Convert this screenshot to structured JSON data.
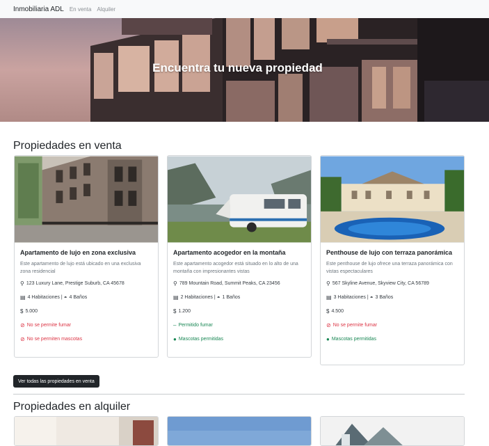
{
  "navbar": {
    "brand": "Inmobiliaria ADL",
    "links": [
      "En venta",
      "Alquiler"
    ]
  },
  "hero": {
    "title": "Encuentra tu nueva propiedad"
  },
  "sale_section": {
    "title": "Propiedades en venta",
    "button": "Ver todas las propiedades en venta",
    "cards": [
      {
        "title": "Apartamento de lujo en zona exclusiva",
        "description": "Este apartamento de lujo está ubicado en una exclusiva zona residencial",
        "address": "123 Luxury Lane, Prestige Suburb, CA 45678",
        "rooms": "4 Habitaciones",
        "baths": "4 Baños",
        "price": "5.000",
        "smoking": "No se permite fumar",
        "pets": "No se permiten mascotas"
      },
      {
        "title": "Apartamento acogedor en la montaña",
        "description": "Este apartamento acogedor está situado en lo alto de una montaña con impresionantes vistas",
        "address": "789 Mountain Road, Summit Peaks, CA 23456",
        "rooms": "2 Habitaciones",
        "baths": "1 Baños",
        "price": "1.200",
        "smoking": "Permitido fumar",
        "pets": "Mascotas permitidas"
      },
      {
        "title": "Penthouse de lujo con terraza panorámica",
        "description": "Este penthouse de lujo ofrece una terraza panorámica con vistas espectaculares",
        "address": "567 Skyline Avenue, Skyview City, CA 56789",
        "rooms": "3 Habitaciones",
        "baths": "3 Baños",
        "price": "4.500",
        "smoking": "No se permite fumar",
        "pets": "Mascotas permitidas"
      }
    ]
  },
  "rent_section": {
    "title": "Propiedades en alquiler"
  },
  "colors": {
    "danger": "#dc3545",
    "success": "#198754",
    "dark": "#212529",
    "navbar": "#f8f9fa"
  },
  "icons": {
    "address": "map-pin-icon",
    "rooms": "bed-icon",
    "baths": "bath-icon",
    "price": "dollar-icon",
    "no": "ban-icon",
    "smoking": "smoking-icon",
    "pets": "paw-icon"
  }
}
